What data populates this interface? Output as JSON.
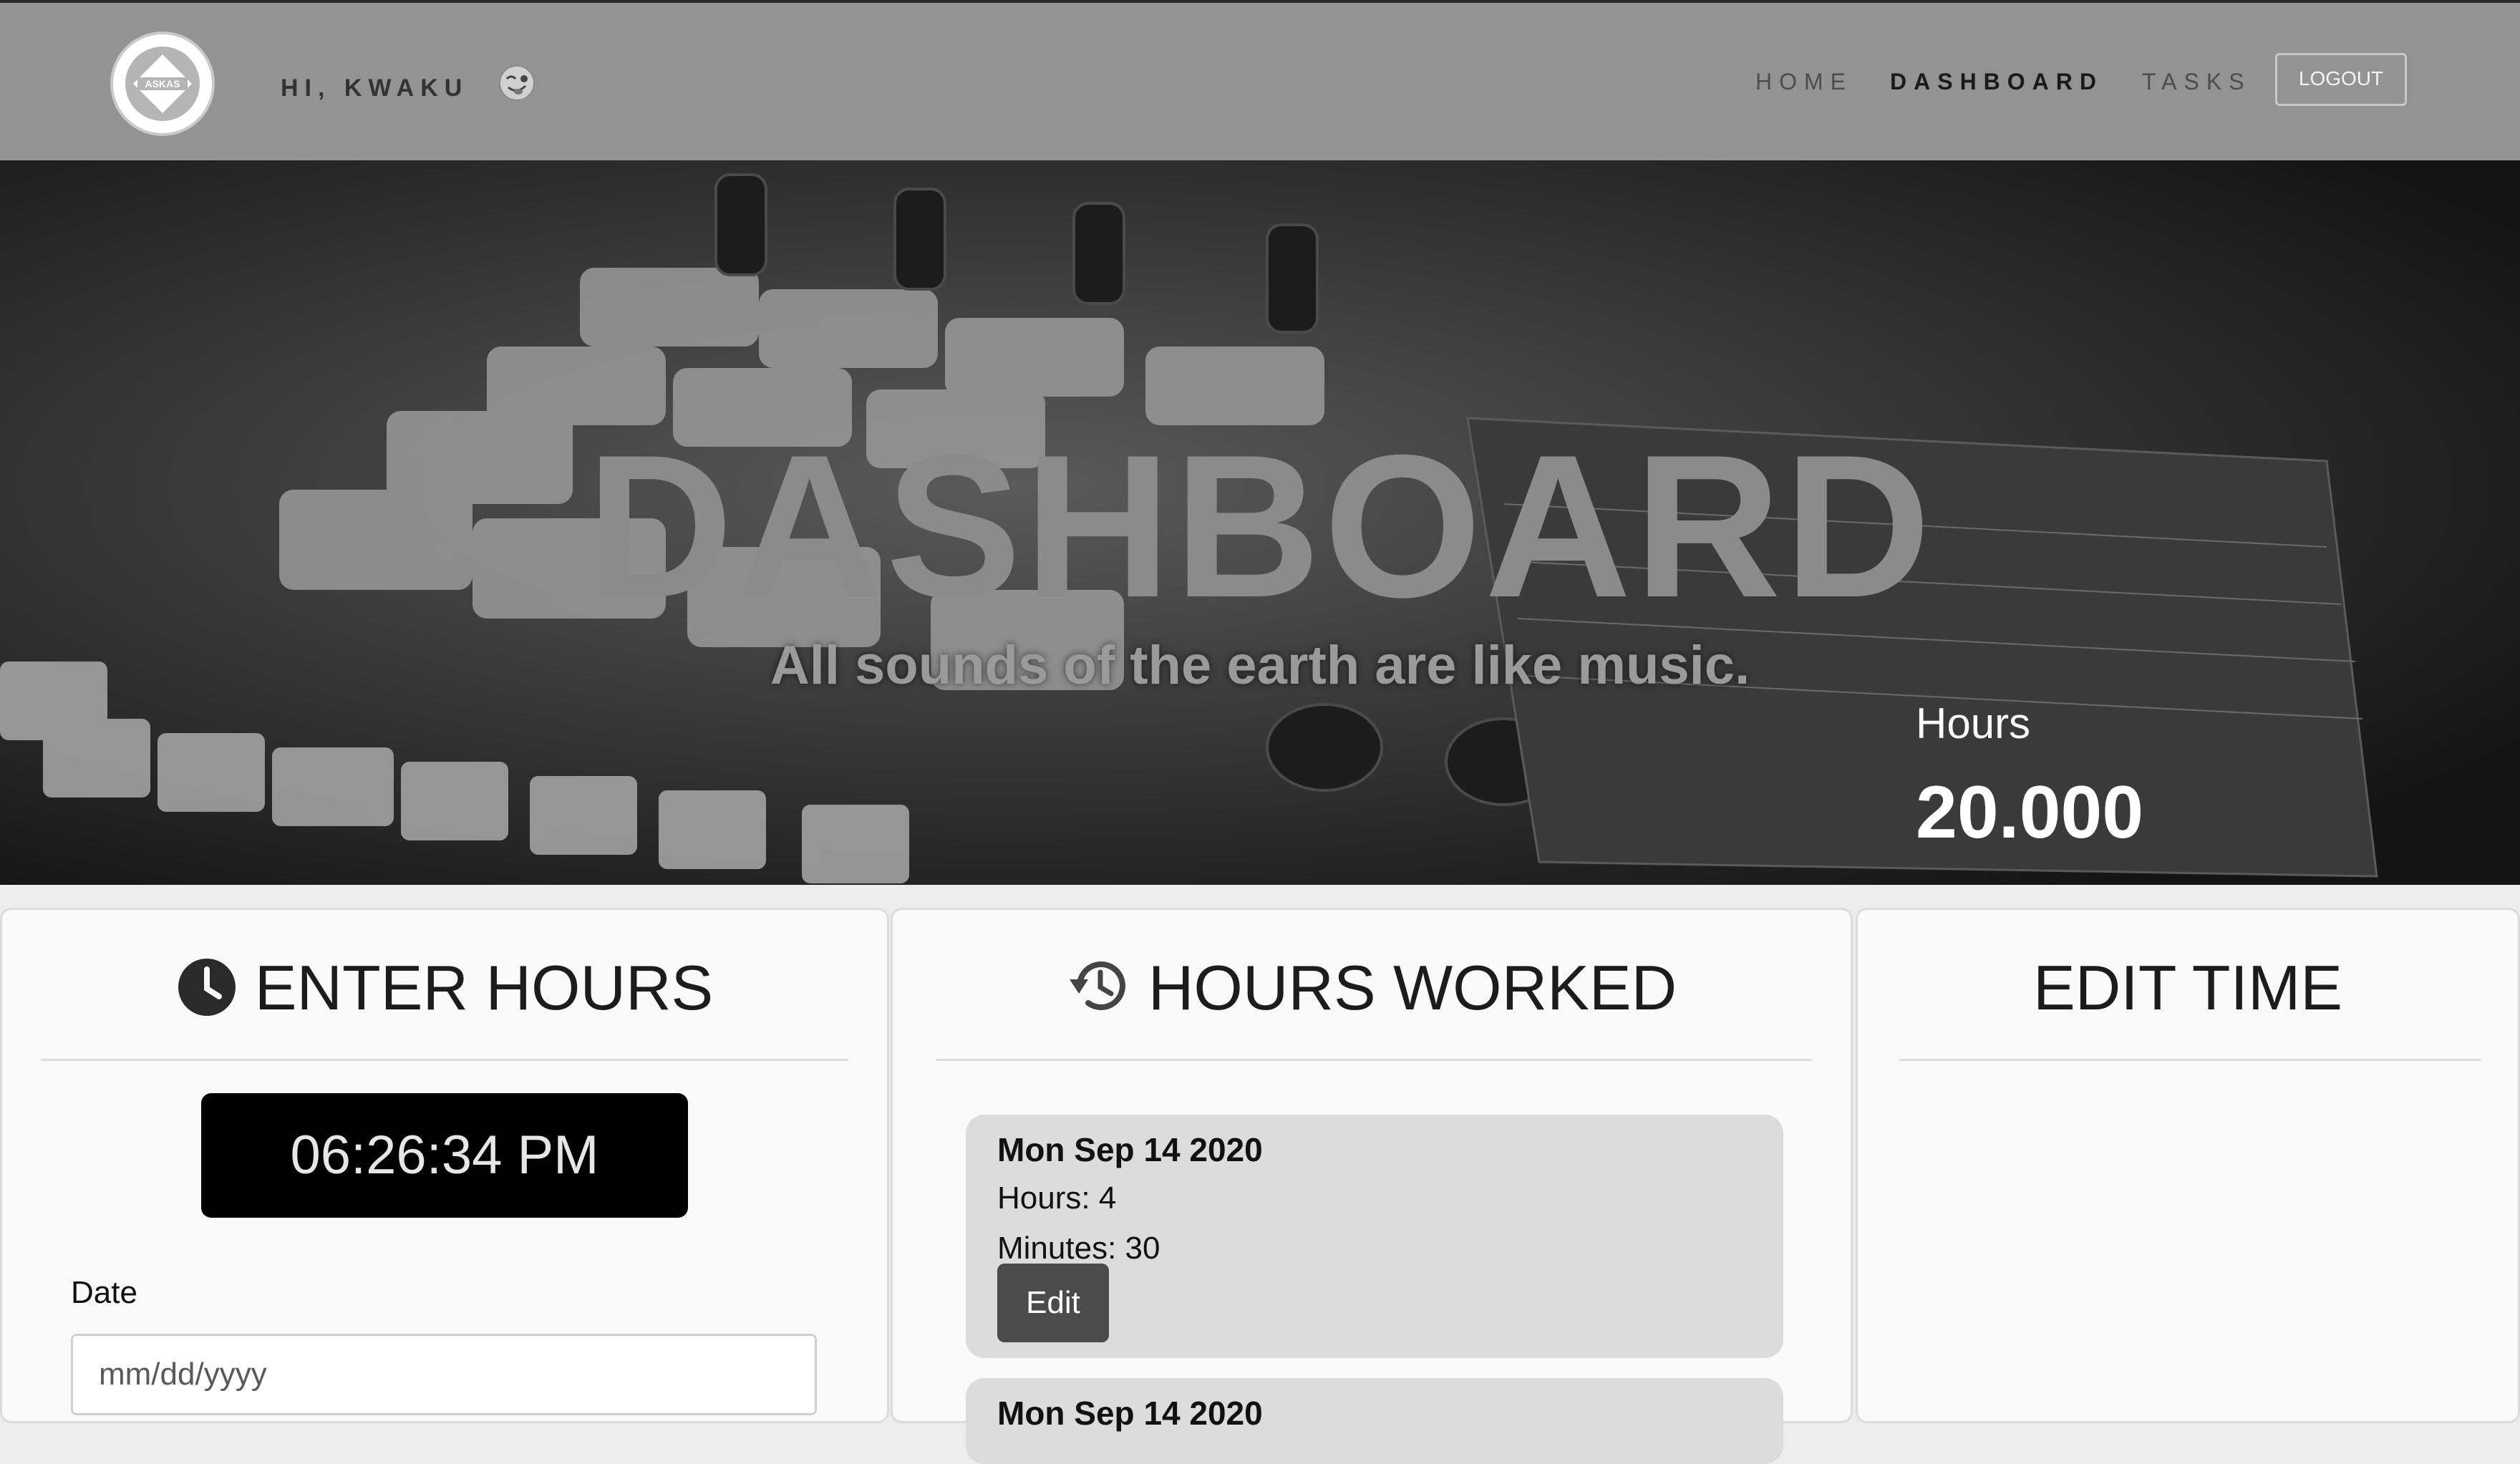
{
  "navbar": {
    "logo_text": "ASKAS",
    "greeting": "HI, KWAKU",
    "links": {
      "home": "HOME",
      "dashboard": "DASHBOARD",
      "tasks": "TASKS"
    },
    "logout_label": "LOGOUT"
  },
  "hero": {
    "title": "DASHBOARD",
    "subtitle": "All sounds of the earth are like music.",
    "hours_label": "Hours",
    "hours_value": "20.000"
  },
  "enter_hours": {
    "title": "ENTER HOURS",
    "clock": "06:26:34 PM",
    "date_label": "Date",
    "date_placeholder": "mm/dd/yyyy"
  },
  "hours_worked": {
    "title": "HOURS WORKED",
    "entries": [
      {
        "date": "Mon Sep 14 2020",
        "hours": "Hours: 4",
        "minutes": "Minutes: 30",
        "edit_label": "Edit"
      },
      {
        "date": "Mon Sep 14 2020"
      }
    ]
  },
  "edit_time": {
    "title": "EDIT TIME"
  }
}
